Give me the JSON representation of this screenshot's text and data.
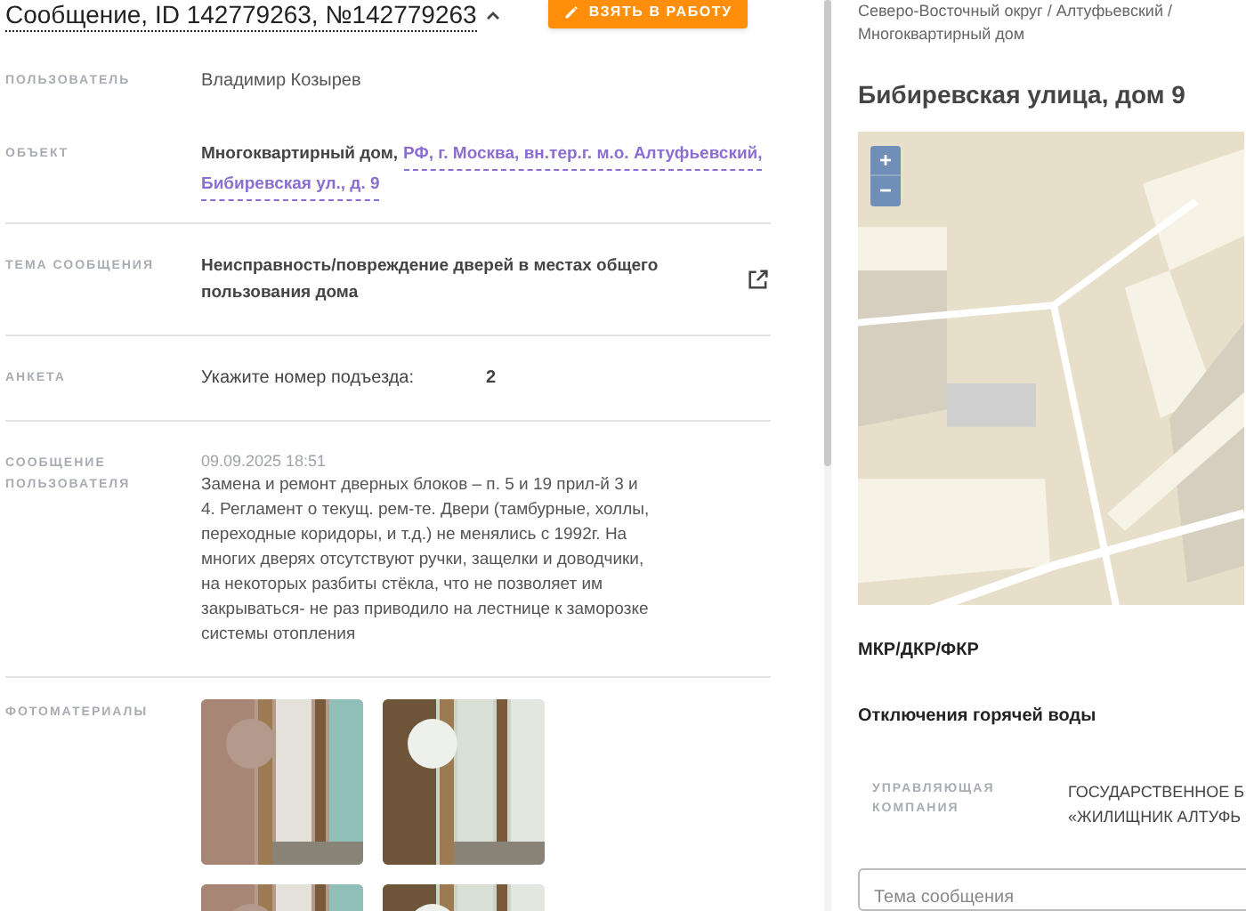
{
  "header": {
    "title": "Сообщение, ID 142779263, №142779263",
    "expanded": true,
    "action_button": "ВЗЯТЬ В РАБОТУ"
  },
  "fields": [
    {
      "kind": "text",
      "label": "ПОЛЬЗОВАТЕЛЬ",
      "value": "Владимир Козырев"
    },
    {
      "kind": "object",
      "label": "ОБЪЕКТ",
      "prefix": "Многоквартирный дом,",
      "link_lines": [
        "РФ, г. Москва, вн.тер.г. м.о. Алтуфьевский,",
        "Бибиревская ул., д. 9"
      ]
    },
    {
      "kind": "topic",
      "label": "ТЕМА СООБЩЕНИЯ",
      "value": "Неисправность/повреждение дверей в местах общего пользования дома"
    },
    {
      "kind": "survey",
      "label": "АНКЕТА",
      "question": "Укажите номер подъезда:",
      "answer": "2"
    },
    {
      "kind": "message",
      "label": "СООБЩЕНИЕ ПОЛЬЗОВАТЕЛЯ",
      "date": "09.09.2025 18:51",
      "value": "Замена и ремонт дверных блоков – п. 5 и 19 прил-й 3 и 4. Регламент о текущ. рем-те. Двери (тамбурные, холлы, переходные коридоры, и т.д.) не менялись с 1992г. На многих дверях отсутствуют ручки, защелки и доводчики, на некоторых разбиты стёкла, что не позволяет им закрываться- не раз приводило на лестнице к заморозке системы отопления"
    },
    {
      "kind": "photos",
      "label": "ФОТОМАТЕРИАЛЫ"
    }
  ],
  "side": {
    "breadcrumb": [
      "Северо-Восточный округ / Алтуфьевский /",
      "Многоквартирный дом"
    ],
    "heading": "Бибиревская улица, дом 9",
    "map": {
      "zoom_in": "+",
      "zoom_out": "−"
    },
    "sections": [
      "МКР/ДКР/ФКР",
      "Отключения горячей воды"
    ],
    "company": {
      "label": "УПРАВЛЯЮЩАЯ КОМПАНИЯ",
      "lines": [
        "ГОСУДАРСТВЕННОЕ Б",
        "«ЖИЛИЩНИК АЛТУФЬ"
      ]
    },
    "message_field": {
      "placeholder": "Тема сообщения"
    }
  }
}
